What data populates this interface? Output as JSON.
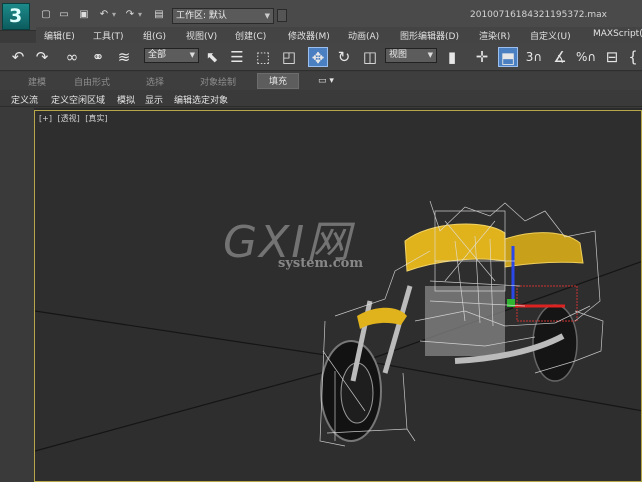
{
  "title_bar": {
    "app_logo_glyph": "3",
    "workspace": "工作区: 默认",
    "filename": "20100716184321195372.max",
    "quick_access_icons": [
      "new-file-icon",
      "open-folder-icon",
      "save-icon",
      "undo-icon",
      "redo-icon",
      "project-folder-icon"
    ]
  },
  "menu": {
    "items": [
      "编辑(E)",
      "工具(T)",
      "组(G)",
      "视图(V)",
      "创建(C)",
      "修改器(M)",
      "动画(A)",
      "图形编辑器(D)",
      "渲染(R)",
      "自定义(U)",
      "MAXScript("
    ]
  },
  "toolbar": {
    "selection_filter": "全部",
    "reference_coord": "视图",
    "snap_label": "3",
    "percent_label": "%"
  },
  "ribbon": {
    "tabs": [
      "建模",
      "自由形式",
      "选择",
      "对象绘制",
      "填充"
    ],
    "active_tab": "填充",
    "extra": "▭ ▾"
  },
  "subbar": {
    "items": [
      "定义流",
      "定义空闲区域",
      "模拟",
      "显示",
      "编辑选定对象"
    ]
  },
  "viewport": {
    "labels": [
      "[+]",
      "[透视]",
      "[真实]"
    ],
    "watermark_main": "GXI网",
    "watermark_sub": "system.com"
  },
  "colors": {
    "accent_blue": "#4a7fc1",
    "viewport_border": "#b8a64a",
    "bike_yellow": "#e0b21c"
  }
}
